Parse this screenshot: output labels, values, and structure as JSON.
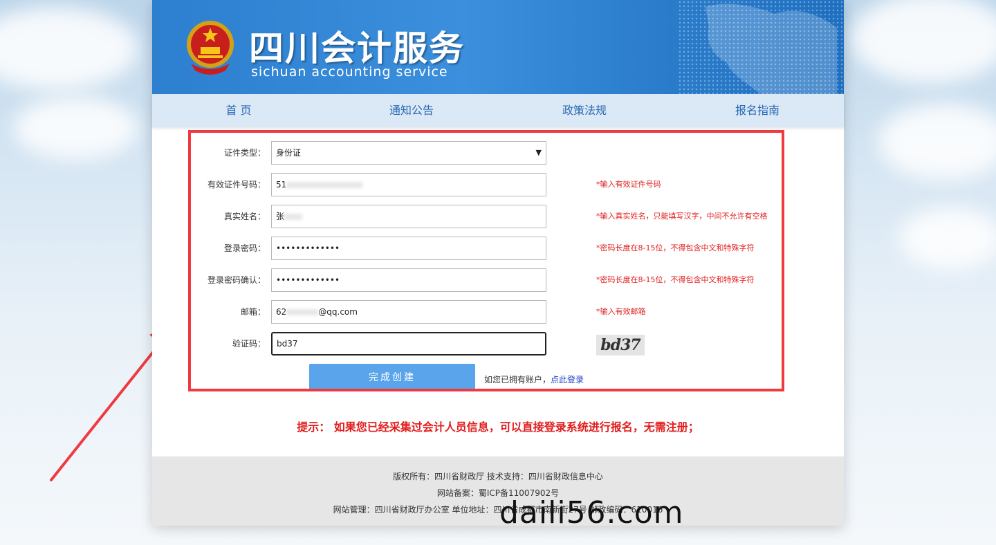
{
  "header": {
    "title": "四川会计服务",
    "subtitle": "sichuan accounting service"
  },
  "nav": {
    "items": [
      "首 页",
      "通知公告",
      "政策法规",
      "报名指南"
    ]
  },
  "form": {
    "id_type": {
      "label": "证件类型：",
      "value": "身份证"
    },
    "id_number": {
      "label": "有效证件号码：",
      "value": "51",
      "hint": "*输入有效证件号码"
    },
    "real_name": {
      "label": "真实姓名：",
      "value": "张",
      "hint": "*输入真实姓名，只能填写汉字，中间不允许有空格"
    },
    "password": {
      "label": "登录密码：",
      "value": "•••••••••••••",
      "hint": "*密码长度在8-15位，不得包含中文和特殊字符"
    },
    "password_confirm": {
      "label": "登录密码确认：",
      "value": "•••••••••••••",
      "hint": "*密码长度在8-15位，不得包含中文和特殊字符"
    },
    "email": {
      "label": "邮箱：",
      "value_prefix": "62",
      "value_suffix": "@qq.com",
      "hint": "*输入有效邮箱"
    },
    "captcha": {
      "label": "验证码：",
      "value": "bd37",
      "image_text": "bd37"
    },
    "submit_label": "完成创建",
    "login_prompt": "如您已拥有账户，",
    "login_link": "点此登录"
  },
  "notice": "提示： 如果您已经采集过会计人员信息，可以直接登录系统进行报名，无需注册；",
  "footer": {
    "line1": "版权所有：四川省财政厅 技术支持：四川省财政信息中心",
    "line2": "网站备案：蜀ICP备11007902号",
    "line3": "网站管理：四川省财政厅办公室 单位地址：四川省成都市南新街27号 邮政编码：610016"
  },
  "watermark": "daili56.com",
  "colors": {
    "brand_blue": "#2d7fcf",
    "nav_bg": "#dbe8f6",
    "highlight_red": "#ef3a3f",
    "hint_red": "#e02020",
    "button_blue": "#5aa4ec"
  }
}
